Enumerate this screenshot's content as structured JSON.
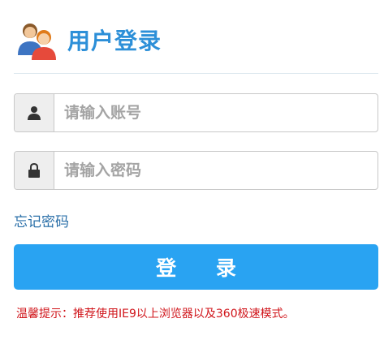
{
  "header": {
    "icon": "users-icon",
    "title": "用户登录"
  },
  "form": {
    "username": {
      "icon": "user-icon",
      "placeholder": "请输入账号",
      "value": ""
    },
    "password": {
      "icon": "lock-icon",
      "placeholder": "请输入密码",
      "value": ""
    },
    "forgot_label": "忘记密码",
    "login_label": "登 录"
  },
  "tip": "温馨提示：推荐使用IE9以上浏览器以及360极速模式。",
  "colors": {
    "title": "#2c8fd8",
    "button": "#29a3f2",
    "link": "#2a6fa8",
    "tip": "#d0141a"
  }
}
